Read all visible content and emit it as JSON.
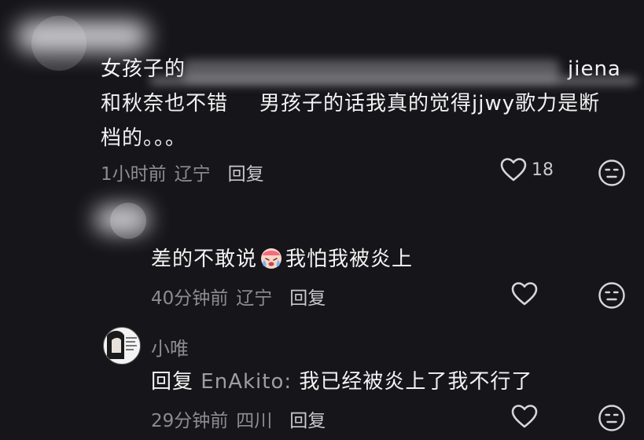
{
  "comment1": {
    "text_line1": "女孩子的",
    "text_line1_tail": "jiena",
    "text_line2a": "和秋奈也不错",
    "text_line2b": "男孩子的话我真的觉得jjwy歌力是断",
    "text_line3": "档的。。。",
    "time": "1小时前",
    "location": "辽宁",
    "reply_label": "回复",
    "like_count": "18"
  },
  "reply1": {
    "text_before_emoji": "差的不敢说",
    "text_after_emoji": "我怕我被炎上",
    "time": "40分钟前",
    "location": "辽宁",
    "reply_label": "回复"
  },
  "reply2": {
    "username": "小唯",
    "reply_prefix": "回复",
    "reply_to": "EnAkito:",
    "text": "我已经被炎上了我不行了",
    "time": "29分钟前",
    "location": "四川",
    "reply_label": "回复"
  },
  "colors": {
    "background": "#161519",
    "text": "#f2f2f2",
    "meta": "#8d8c92"
  },
  "icons": {
    "like": "heart-outline-icon",
    "dislike": "unhappy-face-icon",
    "emoji": "crying-face-emoji"
  }
}
